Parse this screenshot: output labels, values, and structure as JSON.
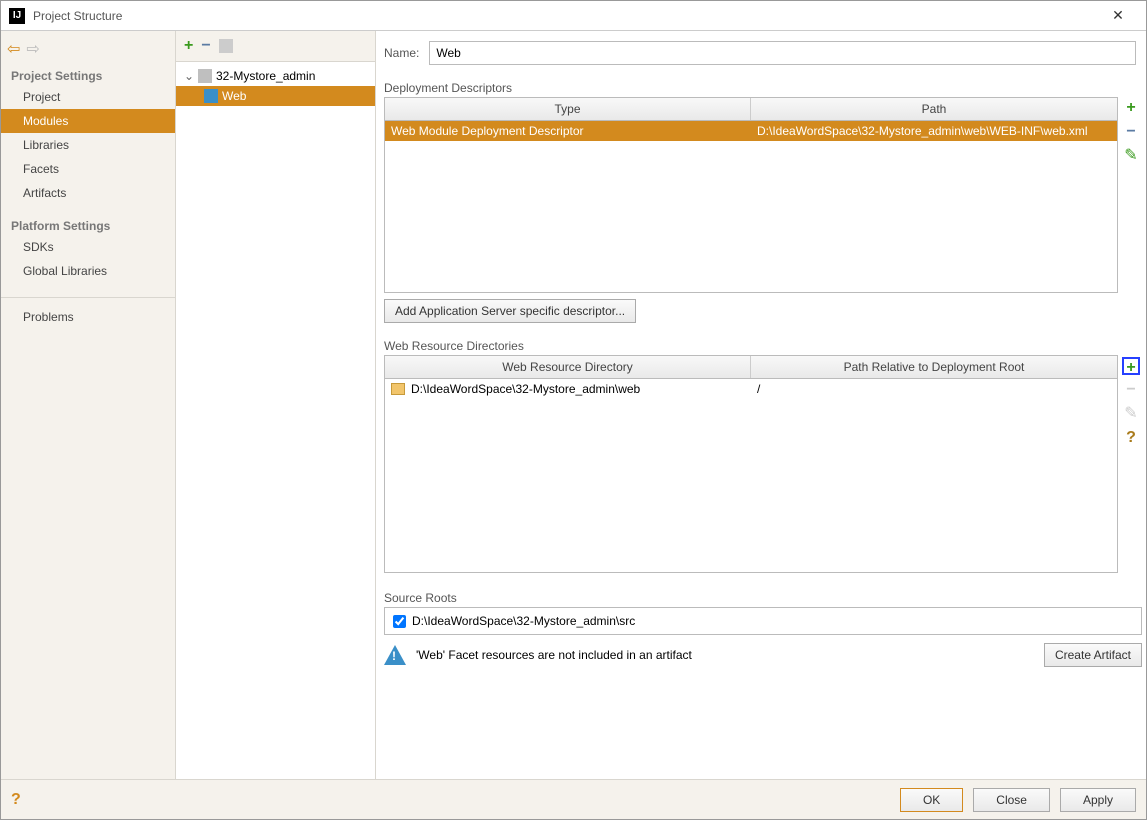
{
  "window": {
    "title": "Project Structure"
  },
  "nav": {
    "projectSettings": "Project Settings",
    "project": "Project",
    "modules": "Modules",
    "libraries": "Libraries",
    "facets": "Facets",
    "artifacts": "Artifacts",
    "platformSettings": "Platform Settings",
    "sdks": "SDKs",
    "globalLibraries": "Global Libraries",
    "problems": "Problems"
  },
  "tree": {
    "root": "32-Mystore_admin",
    "child": "Web"
  },
  "name": {
    "label": "Name:",
    "value": "Web"
  },
  "dd": {
    "section": "Deployment Descriptors",
    "headers": {
      "type": "Type",
      "path": "Path"
    },
    "rows": [
      {
        "type": "Web Module Deployment Descriptor",
        "path": "D:\\IdeaWordSpace\\32-Mystore_admin\\web\\WEB-INF\\web.xml"
      }
    ],
    "addServerBtn": "Add Application Server specific descriptor..."
  },
  "wrd": {
    "section": "Web Resource Directories",
    "headers": {
      "dir": "Web Resource Directory",
      "rel": "Path Relative to Deployment Root"
    },
    "rows": [
      {
        "dir": "D:\\IdeaWordSpace\\32-Mystore_admin\\web",
        "rel": "/"
      }
    ]
  },
  "src": {
    "section": "Source Roots",
    "path": "D:\\IdeaWordSpace\\32-Mystore_admin\\src",
    "checked": true
  },
  "warn": {
    "text": "'Web' Facet resources are not included in an artifact",
    "btn": "Create Artifact"
  },
  "buttons": {
    "ok": "OK",
    "close": "Close",
    "apply": "Apply"
  },
  "icons": {
    "add": "+",
    "remove": "−",
    "edit": "✎",
    "help": "?"
  }
}
